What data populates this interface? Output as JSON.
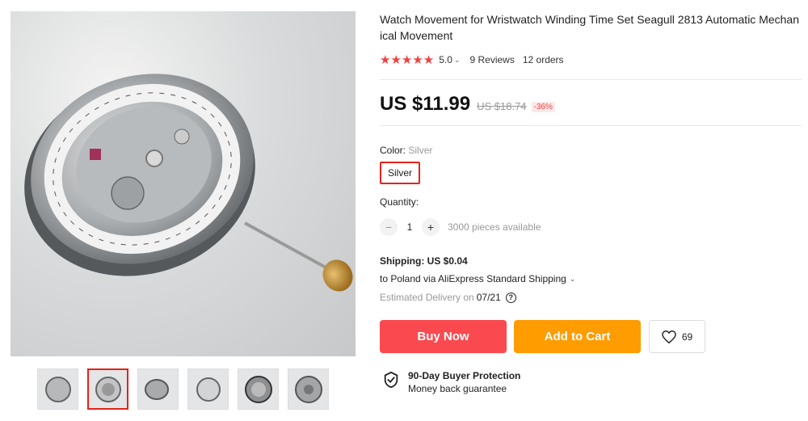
{
  "product": {
    "title": "Watch Movement for Wristwatch Winding Time Set Seagull 2813 Automatic Mechanical Movement",
    "rating": "5.0",
    "stars": "★★★★★",
    "reviews": "9 Reviews",
    "orders": "12 orders",
    "price": "US $11.99",
    "old_price": "US $18.74",
    "discount": "-36%"
  },
  "color": {
    "label": "Color:",
    "selected": "Silver",
    "options": [
      "Silver"
    ]
  },
  "quantity": {
    "label": "Quantity:",
    "value": "1",
    "minus": "−",
    "plus": "+",
    "available": "3000 pieces available"
  },
  "shipping": {
    "title": "Shipping: US $0.04",
    "line": "to Poland via AliExpress Standard Shipping",
    "delivery_label": "Estimated Delivery on",
    "delivery_date": "07/21",
    "help": "?"
  },
  "actions": {
    "buy_now": "Buy Now",
    "add_to_cart": "Add to Cart",
    "wishlist_count": "69"
  },
  "protection": {
    "title": "90-Day Buyer Protection",
    "subtitle": "Money back guarantee"
  },
  "gallery": {
    "thumbnail_count": 6,
    "active_index": 1
  },
  "colors": {
    "accent_red": "#fa4a4f",
    "accent_orange": "#ff9c00",
    "star": "#f53d3d"
  }
}
